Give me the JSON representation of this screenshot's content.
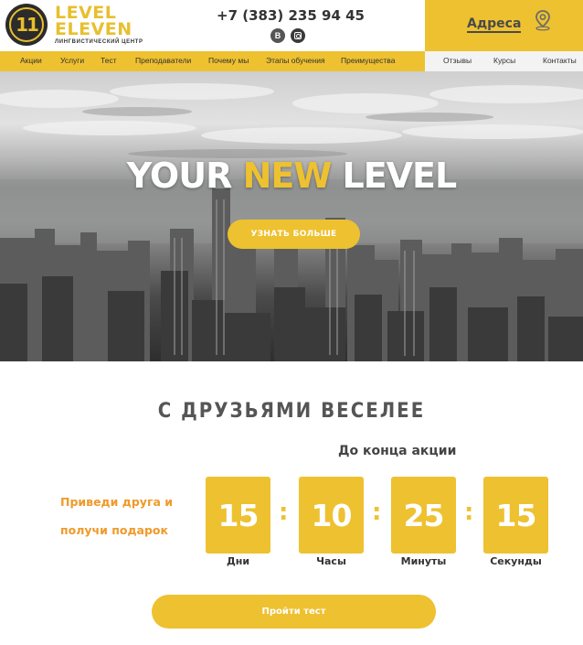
{
  "brand": {
    "logo_glyph": "11",
    "name_line1": "LEVEL",
    "name_line2": "ELEVEN",
    "subtitle": "ЛИНГВИСТИЧЕСКИЙ ЦЕНТР"
  },
  "header": {
    "phone": "+7 (383) 235 94 45",
    "social": [
      {
        "name": "vk-icon",
        "glyph": "В"
      },
      {
        "name": "instagram-icon",
        "glyph": ""
      }
    ],
    "address_label": "Адреса",
    "address_icon": "map-pin-icon"
  },
  "nav": {
    "main": [
      "Акции",
      "Услуги",
      "Тест",
      "Преподаватели",
      "Почему мы",
      "Этапы обучения",
      "Преимущества"
    ],
    "secondary": [
      "Отзывы",
      "Курсы",
      "Контакты"
    ]
  },
  "hero": {
    "title_part1": "YOUR ",
    "title_accent": "NEW",
    "title_part2": " LEVEL",
    "cta_label": "УЗНАТЬ БОЛЬШЕ"
  },
  "promo": {
    "title": "С ДРУЗЬЯМИ ВЕСЕЛЕЕ",
    "countdown_heading": "До конца акции",
    "text_line1": "Приведи друга и",
    "text_line2": "получи подарок",
    "timer": [
      {
        "value": "15",
        "label": "Дни"
      },
      {
        "value": "10",
        "label": "Часы"
      },
      {
        "value": "25",
        "label": "Минуты"
      },
      {
        "value": "15",
        "label": "Секунды"
      }
    ],
    "separator": ":",
    "button_label": "Пройти тест"
  },
  "colors": {
    "accent": "#eec130",
    "promo_text": "#ef9a2a",
    "dark": "#333333"
  }
}
